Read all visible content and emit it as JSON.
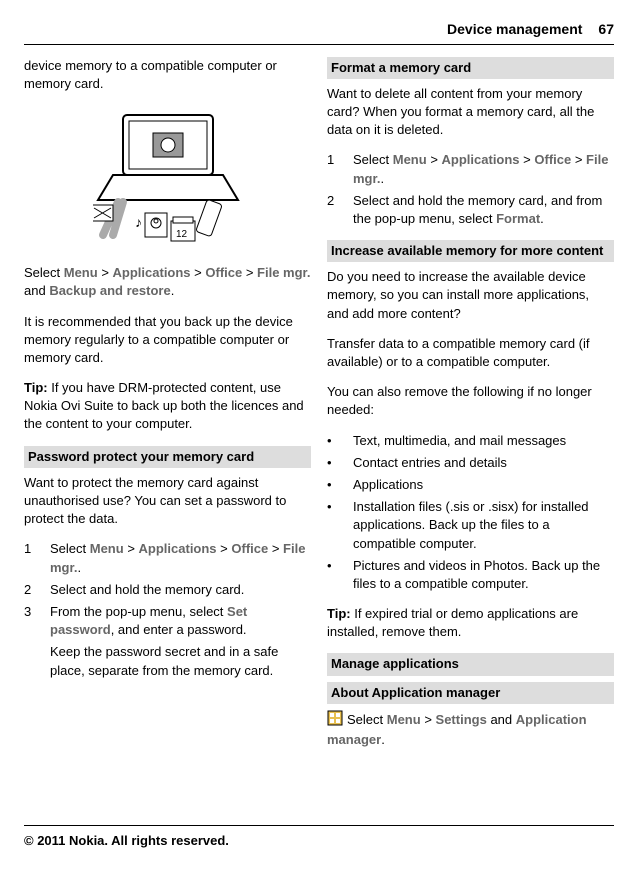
{
  "header": {
    "title": "Device management",
    "page": "67"
  },
  "left": {
    "intro": "device memory to a compatible computer or memory card.",
    "select_line": {
      "pre": "Select ",
      "menu": "Menu",
      "gt1": " > ",
      "apps": "Applications",
      "gt2": " > ",
      "office": "Office",
      "gt3": " > ",
      "filemgr": "File mgr.",
      "and": " and ",
      "backup": "Backup and restore",
      "dot": "."
    },
    "recommend": "It is recommended that you back up the device memory regularly to a compatible computer or memory card.",
    "tip": {
      "label": "Tip:",
      "text": " If you have DRM-protected content, use Nokia Ovi Suite to back up both the licences and the content to your computer."
    },
    "pwd_head": "Password protect your memory card",
    "pwd_intro": "Want to protect the memory card against unauthorised use? You can set a password to protect the data.",
    "steps": [
      {
        "n": "1",
        "pre": "Select ",
        "menu": "Menu",
        "gt1": " > ",
        "apps": "Applications",
        "gt2": " > ",
        "office": "Office",
        "gt3": " > ",
        "filemgr": "File mgr.",
        "dot": "."
      },
      {
        "n": "2",
        "text": "Select and hold the memory card."
      },
      {
        "n": "3",
        "pre": "From the pop-up menu, select ",
        "cmd": "Set password",
        "post": ", and enter a password."
      }
    ],
    "keep_secret": "Keep the password secret and in a safe place, separate from the memory card."
  },
  "right": {
    "format_head": "Format a memory card",
    "format_intro": "Want to delete all content from your memory card? When you format a memory card, all the data on it is deleted.",
    "format_steps": [
      {
        "n": "1",
        "pre": "Select ",
        "menu": "Menu",
        "gt1": " > ",
        "apps": "Applications",
        "gt2": " > ",
        "office": "Office",
        "gt3": " > ",
        "filemgr": "File mgr.",
        "dot": "."
      },
      {
        "n": "2",
        "pre": "Select and hold the memory card, and from the pop-up menu, select ",
        "cmd": "Format",
        "dot": "."
      }
    ],
    "increase_head": "Increase available memory for more content",
    "increase_intro": "Do you need to increase the available device memory, so you can install more applications, and add more content?",
    "increase_transfer": "Transfer data to a compatible memory card (if available) or to a compatible computer.",
    "increase_remove": "You can also remove the following if no longer needed:",
    "bullets": [
      "Text, multimedia, and mail messages",
      "Contact entries and details",
      "Applications",
      "Installation files (.sis or .sisx) for installed applications. Back up the files to a compatible computer.",
      "Pictures and videos in Photos. Back up the files to a compatible computer."
    ],
    "tip2": {
      "label": "Tip:",
      "text": " If expired trial or demo applications are installed, remove them."
    },
    "manage_head": "Manage applications",
    "about_head": "About Application manager",
    "about_line": {
      "pre": "Select ",
      "menu": "Menu",
      "gt1": " > ",
      "settings": "Settings",
      "and": " and ",
      "appmgr": "Application manager",
      "dot": "."
    }
  },
  "footer": "© 2011 Nokia. All rights reserved."
}
